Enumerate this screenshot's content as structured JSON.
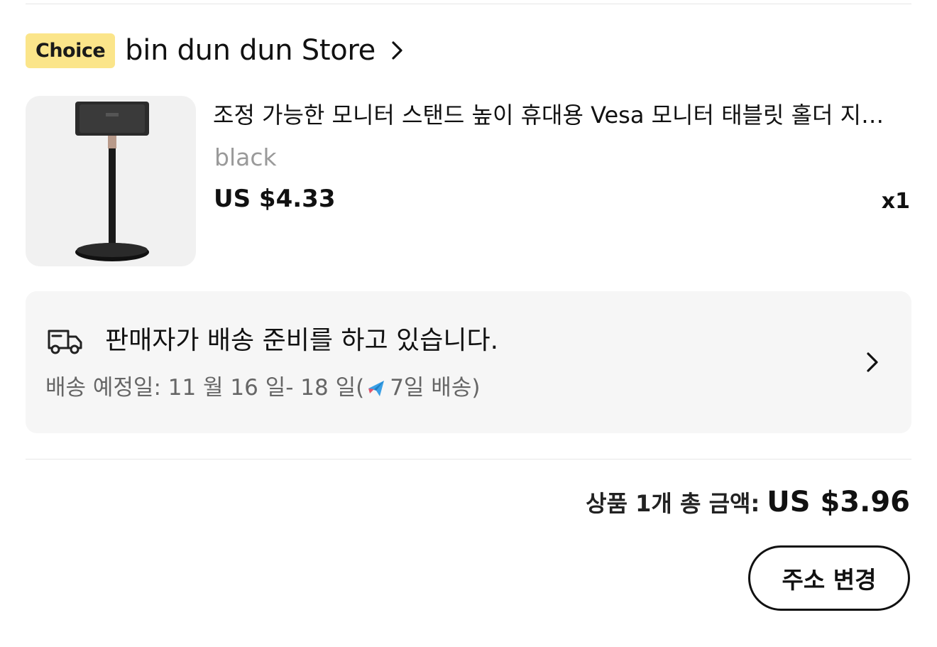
{
  "store": {
    "badge": "Choice",
    "name": "bin dun dun Store",
    "badge_color": "#fbe58a"
  },
  "product": {
    "title": "조정 가능한 모니터 스탠드 높이 휴대용 Vesa 모니터 태블릿 홀더 지지대",
    "variant": "black",
    "price": "US $4.33",
    "quantity": "x1",
    "image_icon": "monitor-stand-photo"
  },
  "shipping": {
    "status": "판매자가 배송 준비를 하고 있습니다.",
    "eta_prefix": "배송 예정일: 11 월 16 일- 18 일(",
    "eta_suffix": "7일 배송)",
    "icons": [
      "truck-icon",
      "airplane-icon",
      "chevron-right-icon"
    ]
  },
  "summary": {
    "total_label": "상품 1개 총 금액:",
    "total_amount": "US $3.96"
  },
  "actions": {
    "change_address": "주소 변경"
  }
}
